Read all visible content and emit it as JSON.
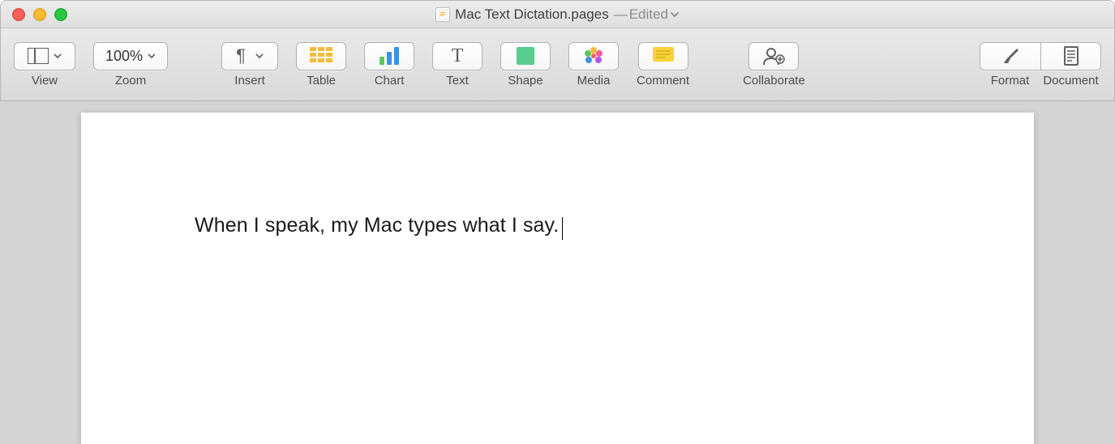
{
  "window": {
    "title": "Mac Text Dictation.pages",
    "status": "Edited"
  },
  "toolbar": {
    "view": "View",
    "zoom_label": "Zoom",
    "zoom_value": "100%",
    "insert": "Insert",
    "table": "Table",
    "chart": "Chart",
    "text": "Text",
    "shape": "Shape",
    "media": "Media",
    "comment": "Comment",
    "collaborate": "Collaborate",
    "format": "Format",
    "document": "Document"
  },
  "document": {
    "body_text": "When I speak, my Mac types what I say."
  }
}
